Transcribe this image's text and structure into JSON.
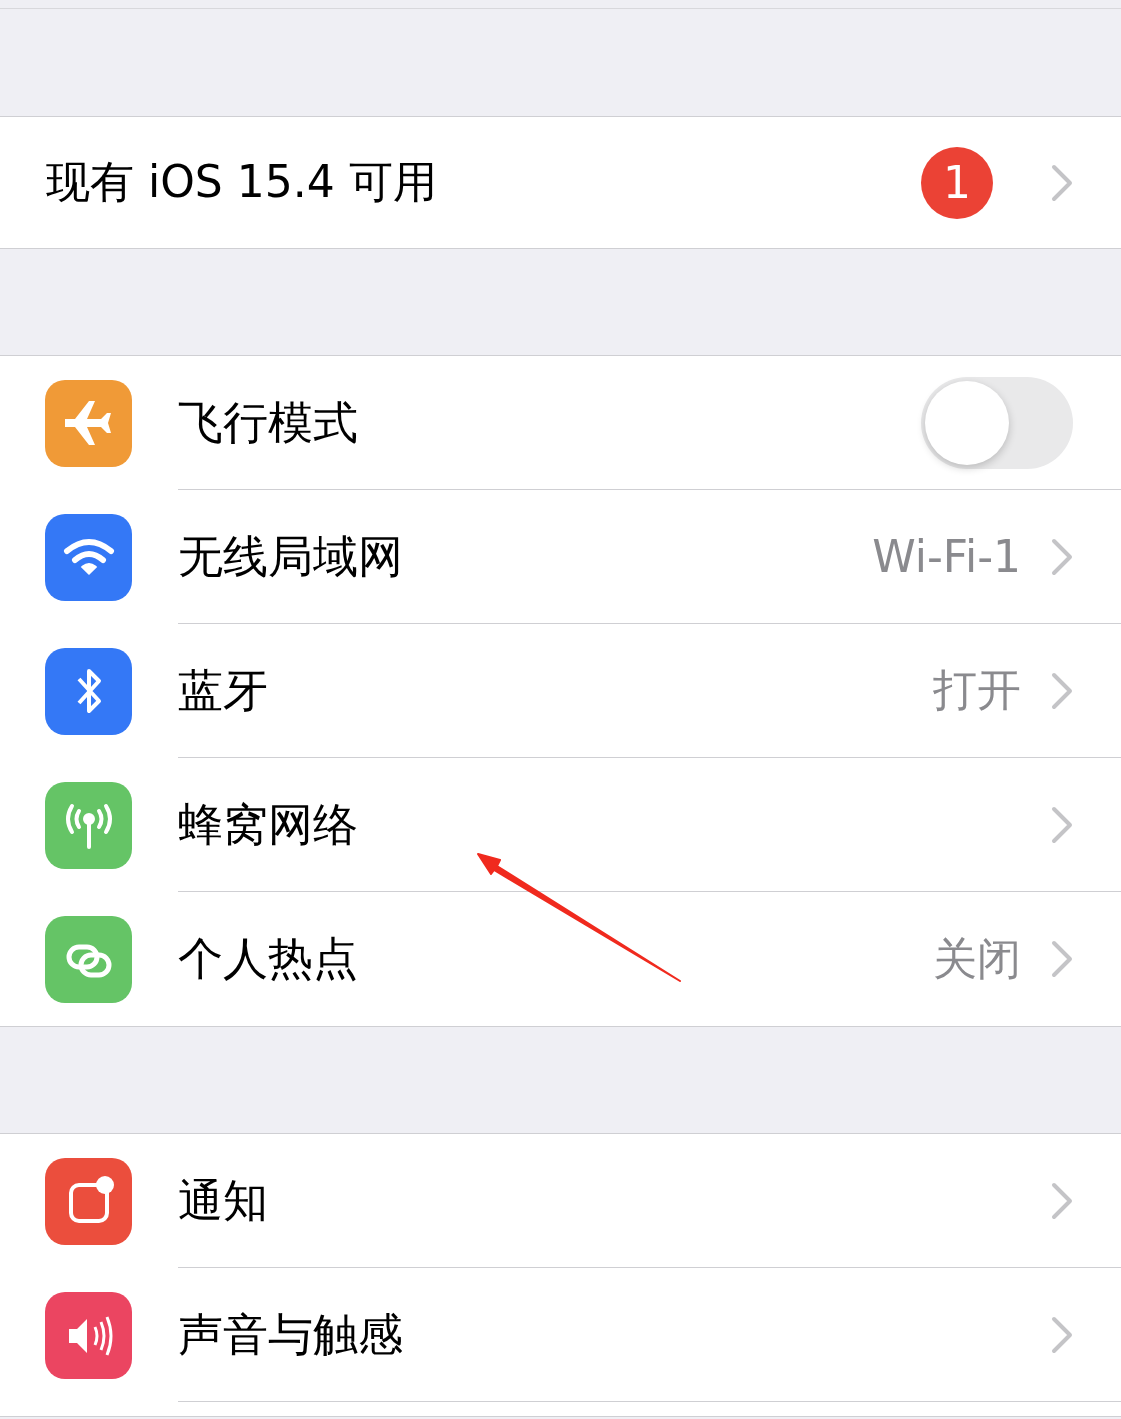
{
  "update_row": {
    "label": "现有 iOS 15.4 可用",
    "badge": "1"
  },
  "groups": [
    {
      "rows": [
        {
          "kind": "toggle",
          "label": "飞行模式",
          "color": "#f09a37",
          "on": false
        },
        {
          "kind": "link",
          "label": "无线局域网",
          "color": "#3478f6",
          "value": "Wi-Fi-1"
        },
        {
          "kind": "link",
          "label": "蓝牙",
          "color": "#3478f6",
          "value": "打开"
        },
        {
          "kind": "link",
          "label": "蜂窝网络",
          "color": "#65c466"
        },
        {
          "kind": "link",
          "label": "个人热点",
          "color": "#65c466",
          "value": "关闭"
        }
      ]
    },
    {
      "rows": [
        {
          "kind": "link",
          "label": "通知",
          "color": "#eb4e3d"
        },
        {
          "kind": "link",
          "label": "声音与触感",
          "color": "#eb4561"
        }
      ]
    }
  ],
  "annotation": {
    "kind": "arrow"
  }
}
